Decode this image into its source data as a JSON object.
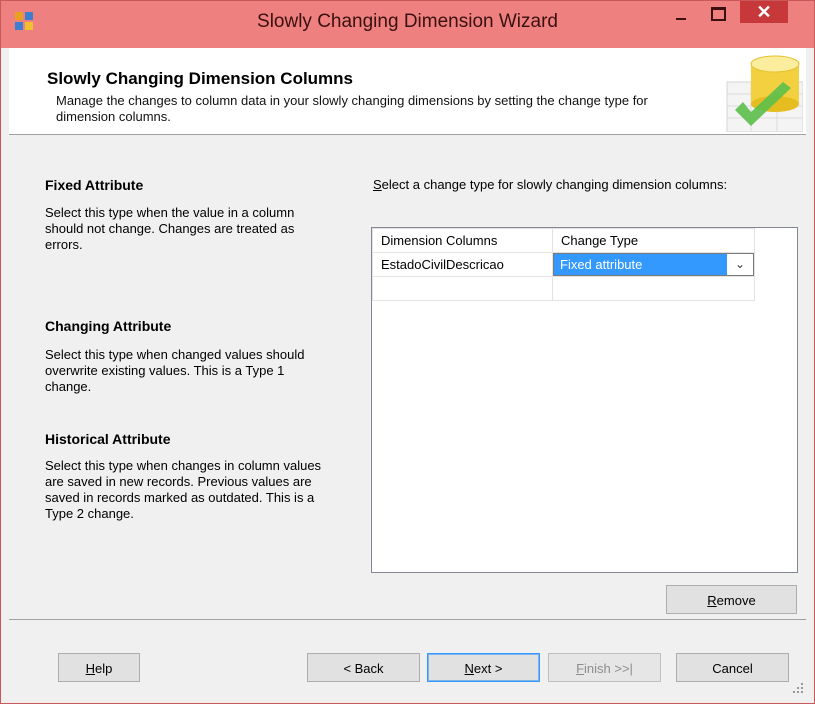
{
  "window": {
    "title": "Slowly Changing Dimension Wizard",
    "close_glyph": "✕"
  },
  "header": {
    "title": "Slowly Changing Dimension Columns",
    "subtitle": "Manage the changes to column data in your slowly changing dimensions by setting the change type for dimension columns."
  },
  "left": {
    "fixed": {
      "title": "Fixed Attribute",
      "text": "Select this type when the value in a column should not change. Changes are treated as errors."
    },
    "changing": {
      "title": "Changing Attribute",
      "text": "Select this type when changed values should overwrite existing values. This is a Type 1 change."
    },
    "historical": {
      "title": "Historical Attribute",
      "text": "Select this type when changes in column values are saved in new records. Previous values are saved in records marked as outdated. This is a Type 2 change."
    }
  },
  "grid": {
    "prompt_u": "S",
    "prompt_rest": "elect a change type for slowly changing dimension columns:",
    "headers": [
      "Dimension Columns",
      "Change Type"
    ],
    "rows": [
      {
        "column": "EstadoCivilDescricao",
        "change_type": "Fixed attribute"
      }
    ],
    "dropdown_arrow": "⌄"
  },
  "buttons": {
    "remove": "Remove",
    "help": "Help",
    "back": "< Back",
    "next": "Next >",
    "finish": "Finish >>|",
    "cancel": "Cancel"
  },
  "colors": {
    "titlebar": "#ef8080",
    "close": "#c7383b",
    "selection": "#3399ff"
  }
}
